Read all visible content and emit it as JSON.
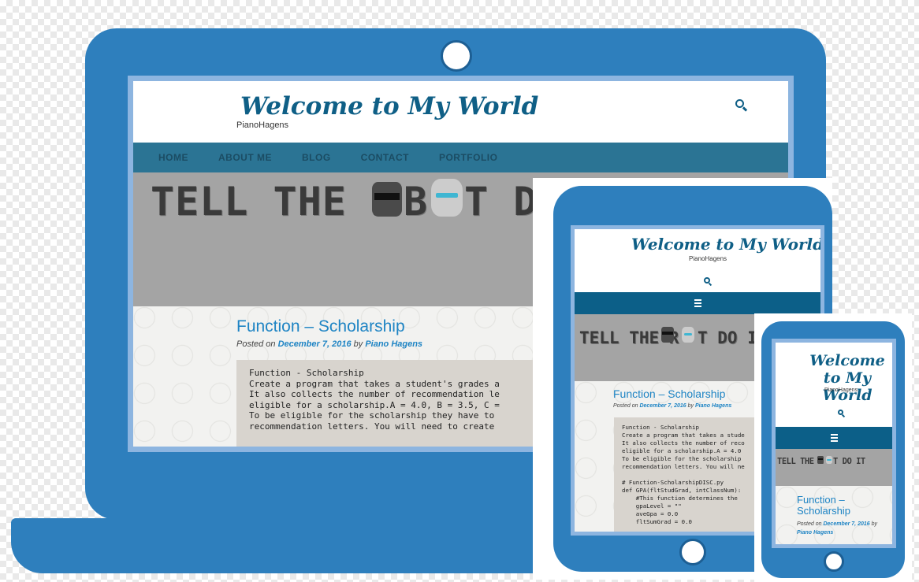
{
  "site": {
    "title": "Welcome to My World",
    "tagline": "PianoHagens",
    "nav": [
      "HOME",
      "ABOUT ME",
      "BLOG",
      "CONTACT",
      "PORTFOLIO"
    ],
    "banner_left": "TELL THE R",
    "banner_mid": "B",
    "banner_right": "T D",
    "banner_tablet_left": "TELL THE R",
    "banner_tablet_right": "T DO IT",
    "banner_phone_left": "TELL THE R",
    "banner_phone_right": "T DO IT"
  },
  "post": {
    "title": "Function – Scholarship",
    "title_line1": "Function –",
    "title_line2": "Scholarship",
    "posted_on": "Posted on",
    "date": "December 7, 2016",
    "by": "by",
    "author": "Piano Hagens"
  },
  "code_laptop": [
    "Function - Scholarship",
    "Create a program that takes a student's grades a",
    "It also collects the number of recommendation le",
    "eligible for a scholarship.A = 4.0, B = 3.5, C =",
    "To be eligible for the scholarship they have to",
    "recommendation letters. You will need to create"
  ],
  "code_tablet": [
    "Function - Scholarship",
    "Create a program that takes a stude",
    "It also collects the number of reco",
    "eligible for a scholarship.A = 4.0",
    "To be eligible for the scholarship",
    "recommendation letters. You will ne",
    "",
    "# Function-ScholarshipDISC.py",
    "def GPA(fltStudGrad, intClassNum):",
    "    #This function determines the",
    "    gpaLevel = \"\"",
    "    aveGpa = 0.0",
    "    fltSumGrad = 0.0"
  ],
  "colors": {
    "device_blue": "#2e7fbd",
    "title_blue": "#0f5f86",
    "link_blue": "#1e84c4",
    "nav_bg": "#2b7494",
    "mobile_bar": "#0c5f88"
  }
}
